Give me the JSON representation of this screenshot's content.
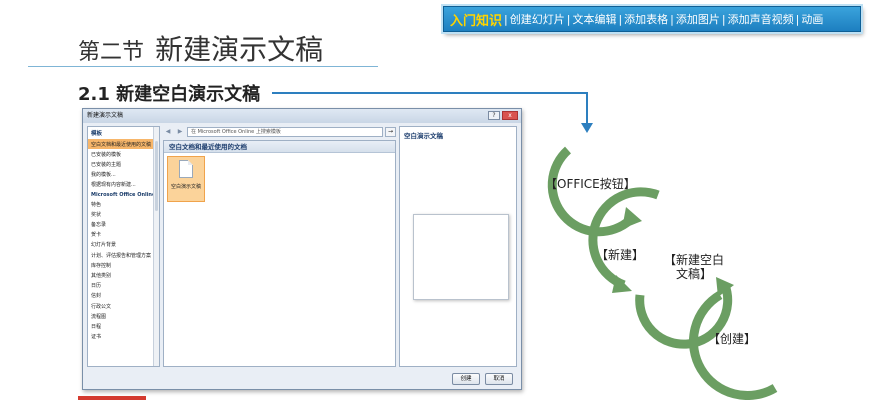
{
  "nav": {
    "active": "入门知识",
    "items": [
      "创建幻灯片",
      "文本编辑",
      "添加表格",
      "添加图片",
      "添加声音视频",
      "动画"
    ]
  },
  "section": {
    "number": "第二节",
    "title": "新建演示文稿"
  },
  "subtitle": "2.1  新建空白演示文稿",
  "dialog": {
    "title": "新建演示文稿",
    "buttons": {
      "help": "?",
      "close": "x"
    },
    "left": {
      "header": "模板",
      "items": [
        {
          "label": "空白文档和最近使用的文稿",
          "style": "sel"
        },
        {
          "label": "已安装的模板",
          "style": ""
        },
        {
          "label": "已安装的主题",
          "style": ""
        },
        {
          "label": "我的模板...",
          "style": ""
        },
        {
          "label": "根据现有内容新建...",
          "style": ""
        },
        {
          "label": "Microsoft Office Online",
          "style": "bold"
        },
        {
          "label": "特色",
          "style": ""
        },
        {
          "label": "奖状",
          "style": ""
        },
        {
          "label": "备忘录",
          "style": ""
        },
        {
          "label": "贺卡",
          "style": ""
        },
        {
          "label": "幻灯片背景",
          "style": ""
        },
        {
          "label": "计划、评估报告和管理方案",
          "style": ""
        },
        {
          "label": "库存控制",
          "style": ""
        },
        {
          "label": "其他类别",
          "style": ""
        },
        {
          "label": "日历",
          "style": ""
        },
        {
          "label": "信封",
          "style": ""
        },
        {
          "label": "行政公文",
          "style": ""
        },
        {
          "label": "流程图",
          "style": ""
        },
        {
          "label": "日程",
          "style": ""
        },
        {
          "label": "证书",
          "style": ""
        }
      ]
    },
    "address_placeholder": "在 Microsoft Office Online 上搜索模板",
    "go": "→",
    "middle_header": "空白文档和最近使用的文档",
    "tile_label": "空白演示文稿",
    "preview_title": "空白演示文稿",
    "ok": "创建",
    "cancel": "取消"
  },
  "flow": {
    "step1": "【OFFICE按钮】",
    "step2": "【新建】",
    "step3_line1": "【新建空白",
    "step3_line2": "文稿】",
    "step4": "【创建】",
    "color": "#6b9e62"
  }
}
